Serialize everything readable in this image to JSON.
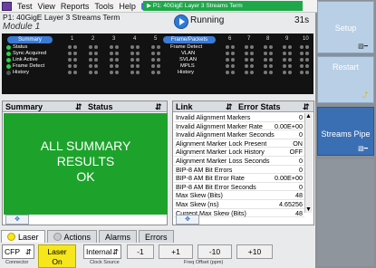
{
  "menu": {
    "items": [
      "Test",
      "View",
      "Reports",
      "Tools",
      "Help"
    ]
  },
  "active_tab": "P1: 40GigE Layer 3 Streams Term",
  "header": {
    "title": "P1: 40GigE Layer 3 Streams Term",
    "subtitle": "Module 1",
    "status": "Running",
    "elapsed": "31s"
  },
  "led_panel": {
    "summary_label": "Summary",
    "summary_items": [
      "Status",
      "Sync Acquired",
      "Link Active",
      "Frame Detect",
      "History"
    ],
    "lane_numbers_left": [
      "1",
      "2",
      "3",
      "4",
      "5"
    ],
    "frames_label": "Frame/Packets",
    "frame_items": [
      "Frame Detect",
      "VLAN",
      "SVLAN",
      "MPLS",
      "History"
    ],
    "lane_numbers_right": [
      "6",
      "7",
      "8",
      "9",
      "10"
    ]
  },
  "left_pane": {
    "col1": "Summary",
    "col2": "Status",
    "results": [
      "ALL SUMMARY",
      "RESULTS",
      "OK"
    ]
  },
  "right_pane": {
    "col1": "Link",
    "col2": "Error Stats",
    "rows": [
      {
        "label": "Invalid Alignment Markers",
        "value": "0"
      },
      {
        "label": "Invalid Alignment Marker Rate",
        "value": "0.00E+00"
      },
      {
        "label": "Invalid Alignment Marker Seconds",
        "value": "0"
      },
      {
        "label": "Alignment Marker Lock Present",
        "value": "ON"
      },
      {
        "label": "Alignment Marker Lock History",
        "value": "OFF"
      },
      {
        "label": "Alignment Marker Loss Seconds",
        "value": "0"
      },
      {
        "label": "BIP-8 AM Bit Errors",
        "value": "0"
      },
      {
        "label": "BIP-8 AM Bit Error Rate",
        "value": "0.00E+00"
      },
      {
        "label": "BIP-8 AM Bit Error Seconds",
        "value": "0"
      },
      {
        "label": "Max Skew (Bits)",
        "value": "48"
      },
      {
        "label": "Max Skew (ns)",
        "value": "4.65256"
      },
      {
        "label": "Current Max Skew (Bits)",
        "value": "48"
      }
    ]
  },
  "bottom_tabs": [
    "Laser",
    "Actions",
    "Alarms",
    "Errors"
  ],
  "controls": {
    "connector_value": "CFP",
    "connector_caption": "Connector",
    "laser_label": "Laser",
    "laser_state": "On",
    "clock_value": "Internal",
    "clock_caption": "Clock Source",
    "offsets": [
      "-1",
      "+1",
      "-10",
      "+10"
    ],
    "freq_caption": "Freq Offset (ppm)"
  },
  "side_buttons": {
    "setup": "Setup",
    "restart": "Restart",
    "streams": "Streams Pipe"
  },
  "colors": {
    "running_green": "#1da32c",
    "tab_green": "#1ea84a",
    "laser_yellow": "#f6e61c",
    "side_blue": "#b9cfe6"
  }
}
